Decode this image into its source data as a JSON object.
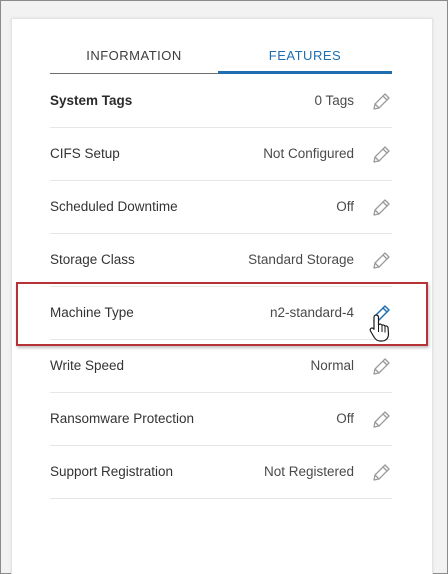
{
  "tabs": [
    {
      "label": "INFORMATION",
      "active": false
    },
    {
      "label": "FEATURES",
      "active": true
    }
  ],
  "rows": [
    {
      "label": "System Tags",
      "value": "0 Tags"
    },
    {
      "label": "CIFS Setup",
      "value": "Not Configured"
    },
    {
      "label": "Scheduled Downtime",
      "value": "Off"
    },
    {
      "label": "Storage Class",
      "value": "Standard Storage"
    },
    {
      "label": "Machine Type",
      "value": "n2-standard-4",
      "highlighted": true
    },
    {
      "label": "Write Speed",
      "value": "Normal"
    },
    {
      "label": "Ransomware Protection",
      "value": "Off"
    },
    {
      "label": "Support Registration",
      "value": "Not Registered"
    }
  ],
  "colors": {
    "accent": "#1f6fb0",
    "highlight_border": "#b73237",
    "edit_icon": "#9a9a9a",
    "edit_icon_active": "#1f6fb0"
  },
  "icons": {
    "edit": "pencil-icon",
    "cursor": "hand-pointer-icon"
  }
}
